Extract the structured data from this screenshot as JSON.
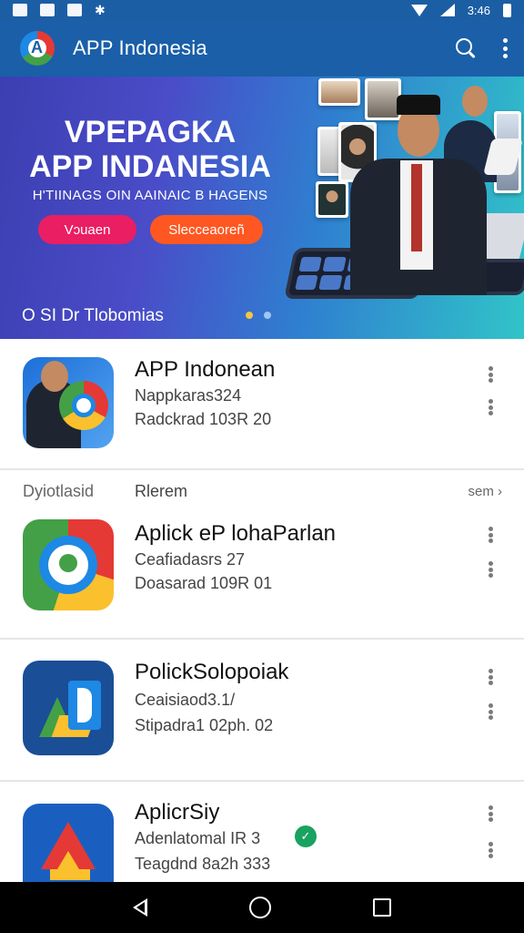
{
  "status_bar": {
    "time": "3:46"
  },
  "app_bar": {
    "title": "APP Indonesia"
  },
  "banner": {
    "headline_line1": "VPEPAGKA",
    "headline_line2": "APP INDANESIA",
    "tagline": "H'TIINAGS OIN AAINAIC B HAGENS",
    "primary_button": "Vɔuaen",
    "secondary_button": "Slecceaoreñ",
    "caption": "O SI Dr Tlobomias",
    "page_count": 2,
    "active_page": 1
  },
  "apps": [
    {
      "name": "APP Indonean",
      "line1": "Nappkaras324",
      "line2": "Radckrad 103R 20"
    },
    {
      "name": "Aplick eP lohaParlan",
      "line1": "Ceafiadasrs 27",
      "line2": "Doasarad 109R 01"
    },
    {
      "name": "PolickSolopoiak",
      "line1": "Ceaisiaod3.1/",
      "line2": "Stipadra1 02ph. 02"
    },
    {
      "name": "AplicrSiy",
      "line1": "Adenlatomal IR 3",
      "line2": "Teagdnd 8a2h 333"
    }
  ],
  "section": {
    "left_label": "Dyiotlasid",
    "title": "Rlerem",
    "see_more": "sem"
  },
  "colors": {
    "primary": "#1a5fa8",
    "pink": "#e91e63",
    "orange": "#ff5722",
    "badge": "#1aa260"
  }
}
